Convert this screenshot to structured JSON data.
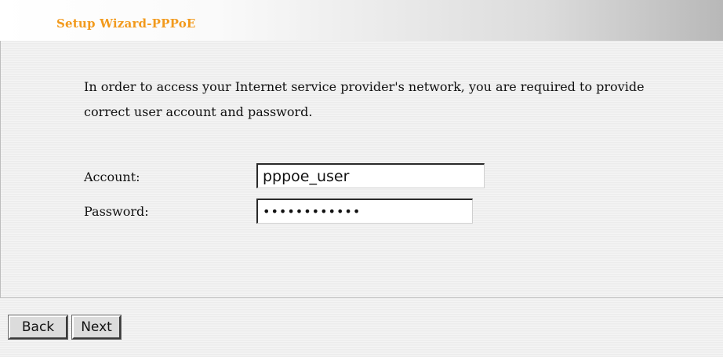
{
  "header": {
    "title": "Setup Wizard-PPPoE"
  },
  "intro": {
    "text": "In order to access your Internet service provider's network, you are required to provide correct user account and password."
  },
  "form": {
    "account_label": "Account:",
    "account_value": "pppoe_user",
    "password_label": "Password:",
    "password_value": "pppoepasswd1"
  },
  "buttons": {
    "back_label": "Back",
    "next_label": "Next"
  },
  "colors": {
    "title": "#f29a1d",
    "background": "#f2f2f2"
  }
}
